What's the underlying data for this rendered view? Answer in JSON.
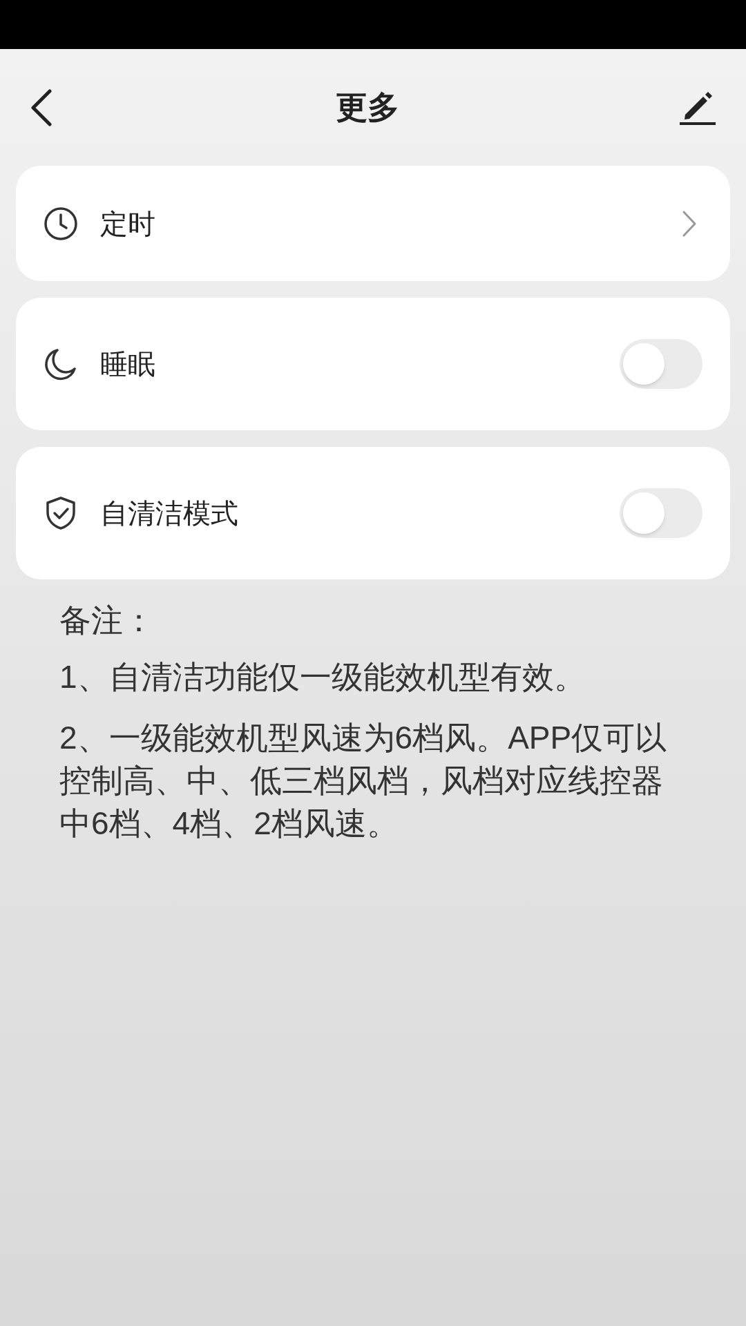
{
  "header": {
    "title": "更多"
  },
  "items": [
    {
      "kind": "link",
      "label": "定时"
    },
    {
      "kind": "toggle",
      "label": "睡眠",
      "on": false
    },
    {
      "kind": "toggle",
      "label": "自清洁模式",
      "on": false
    }
  ],
  "notes": {
    "heading": "备注：",
    "lines": [
      "1、自清洁功能仅一级能效机型有效。",
      "2、一级能效机型风速为6档风。APP仅可以控制高、中、低三档风档，风档对应线控器中6档、4档、2档风速。"
    ]
  }
}
